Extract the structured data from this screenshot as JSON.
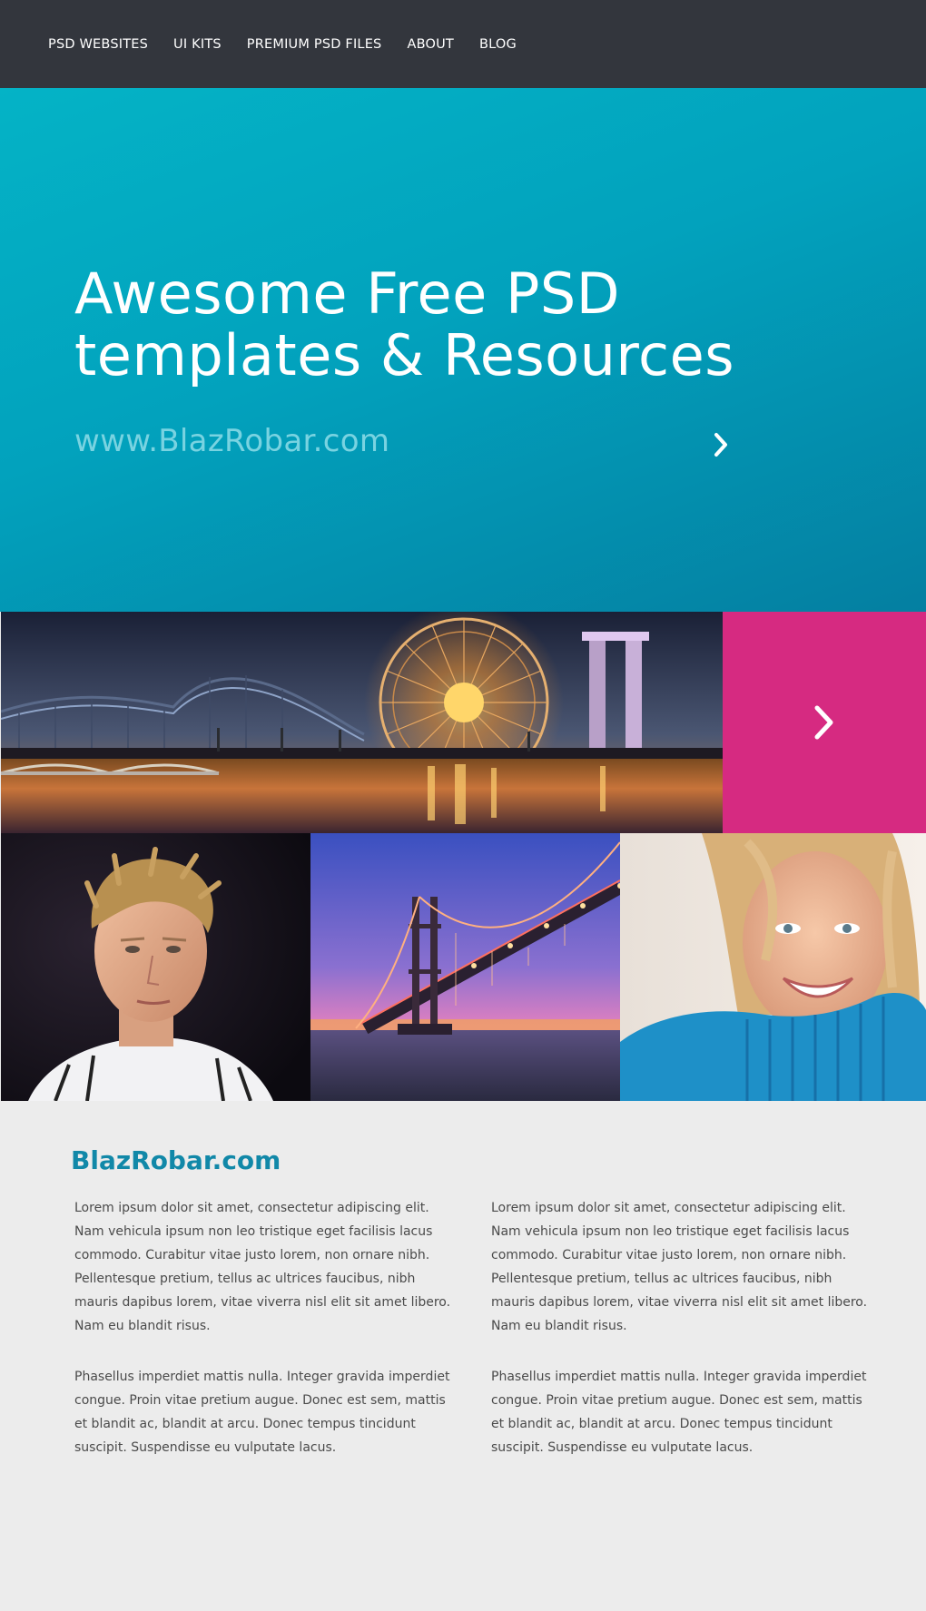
{
  "nav": {
    "items": [
      {
        "label": "PSD WEBSITES"
      },
      {
        "label": "UI KITS"
      },
      {
        "label": "PREMIUM PSD FILES"
      },
      {
        "label": "ABOUT"
      },
      {
        "label": "BLOG"
      }
    ]
  },
  "hero": {
    "title_line1": "Awesome Free PSD",
    "title_line2": "templates & Resources",
    "url": "www.BlazRobar.com",
    "next_icon": "chevron-right-icon",
    "background": "#02a2bd"
  },
  "gallery": {
    "accent_color": "#d62a81",
    "next_icon": "chevron-right-icon"
  },
  "content": {
    "title": "BlazRobar.com",
    "title_color": "#1188a8",
    "left": {
      "p1": "Lorem ipsum dolor sit amet, consectetur adipiscing elit. Nam vehicula ipsum non leo tristique eget facilisis lacus commodo. Curabitur vitae justo lorem, non ornare nibh. Pellentesque pretium, tellus ac ultrices faucibus, nibh mauris dapibus lorem, vitae viverra nisl elit sit amet libero. Nam eu blandit risus.",
      "p2": "Phasellus imperdiet mattis nulla. Integer gravida imperdiet congue. Proin vitae pretium augue. Donec est sem, mattis et blandit ac, blandit at arcu. Donec tempus tincidunt suscipit. Suspendisse eu vulputate lacus."
    },
    "right": {
      "p1": "Lorem ipsum dolor sit amet, consectetur adipiscing elit. Nam vehicula ipsum non leo tristique eget facilisis lacus commodo. Curabitur vitae justo lorem, non ornare nibh. Pellentesque pretium, tellus ac ultrices faucibus, nibh mauris dapibus lorem, vitae viverra nisl elit sit amet libero. Nam eu blandit risus.",
      "p2": "Phasellus imperdiet mattis nulla. Integer gravida imperdiet congue. Proin vitae pretium augue. Donec est sem, mattis et blandit ac, blandit at arcu. Donec tempus tincidunt suscipit. Suspendisse eu vulputate lacus."
    }
  }
}
